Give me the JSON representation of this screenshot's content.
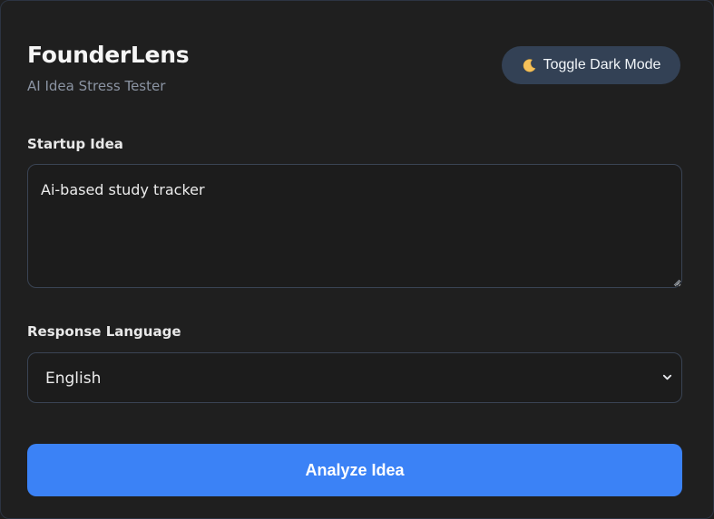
{
  "app": {
    "title": "FounderLens",
    "subtitle": "AI Idea Stress Tester"
  },
  "toolbar": {
    "toggle_label": "Toggle Dark Mode",
    "toggle_icon": "moon-icon"
  },
  "form": {
    "idea_label": "Startup Idea",
    "idea_value": "Ai-based study tracker",
    "language_label": "Response Language",
    "language_selected": "English",
    "analyze_label": "Analyze Idea"
  },
  "colors": {
    "background": "#1f1f1f",
    "accent": "#3b82f6",
    "toggle_bg": "#334155",
    "field_border": "#3a4454"
  }
}
